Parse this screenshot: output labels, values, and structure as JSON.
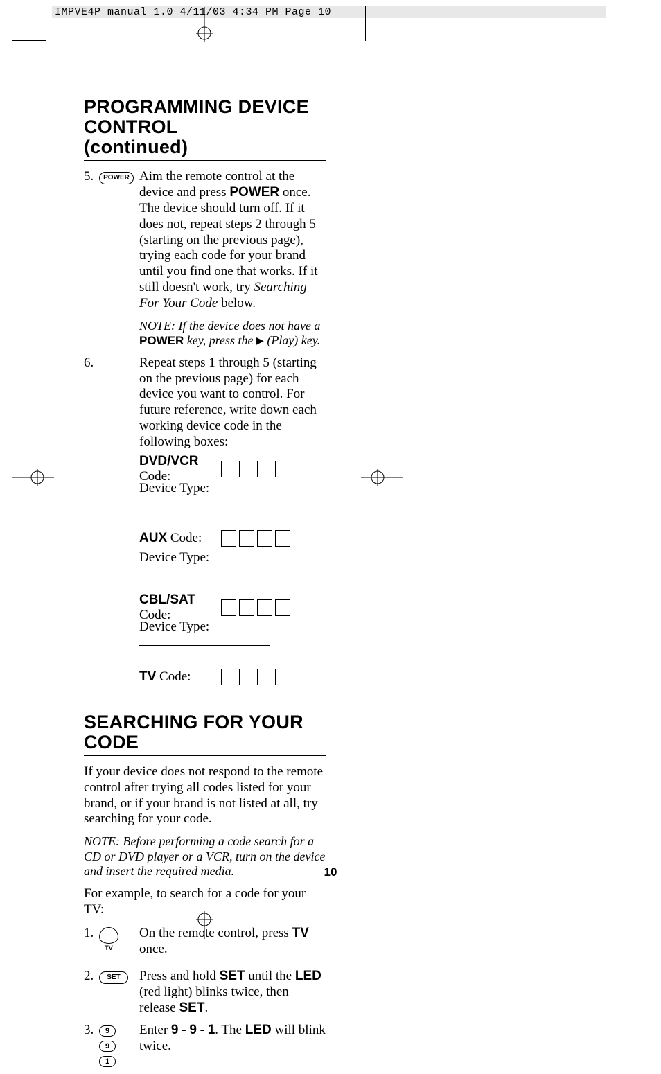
{
  "header": {
    "line": "IMPVE4P manual 1.0  4/11/03  4:34 PM  Page 10"
  },
  "sectionA": {
    "title_l1": "PROGRAMMING DEVICE CONTROL",
    "title_l2": "(continued)"
  },
  "step5": {
    "num": "5.",
    "button": "POWER",
    "body": "Aim the remote control at the device and press POWER once. The device should turn off. If it does not, repeat steps 2 through 5 (starting on the previous page), trying each code for your brand until you find one that works. If it still doesn't work, try Searching For Your Code below.",
    "note_pre": "NOTE: If the device does not have a ",
    "note_boldword": "POWER",
    "note_mid": " key, press the ",
    "note_play": "▶",
    "note_post": " (Play) key."
  },
  "step6": {
    "num": "6.",
    "body": "Repeat steps 1 through 5 (starting on the previous page) for each device you want to control. For future reference, write down each working device code in the following boxes:"
  },
  "codes": {
    "dvd_label": "DVD/VCR",
    "aux_label": "AUX",
    "cbl_label": "CBL/SAT",
    "tv_label": "TV",
    "suffix": " Code:",
    "device_type": "Device Type:"
  },
  "sectionB": {
    "title": "SEARCHING FOR YOUR CODE",
    "intro": "If your device does not respond to the remote control after trying all codes listed for your brand, or if your brand is not listed at all, try searching for your code.",
    "note": "NOTE: Before performing a code search for a CD or DVD player or a VCR, turn on the device and insert the required media.",
    "lead": "For example, to search for a code for your TV:",
    "s1": {
      "num": "1.",
      "btn": "TV",
      "body_pre": "On the remote control, press ",
      "body_bold": "TV",
      "body_post": " once."
    },
    "s2": {
      "num": "2.",
      "btn": "SET",
      "body_pre": "Press and hold ",
      "b1": "SET",
      "mid1": " until the ",
      "b2": "LED",
      "mid2": " (red light) blinks twice, then release ",
      "b3": "SET",
      "post": "."
    },
    "s3": {
      "num": "3.",
      "body_pre": "Enter ",
      "n1": "9",
      "dash1": " - ",
      "n2": " 9",
      "dash2": " - ",
      "n3": "1",
      "mid": ". The ",
      "b1": "LED",
      "post": " will blink twice."
    }
  },
  "page_number": "10"
}
